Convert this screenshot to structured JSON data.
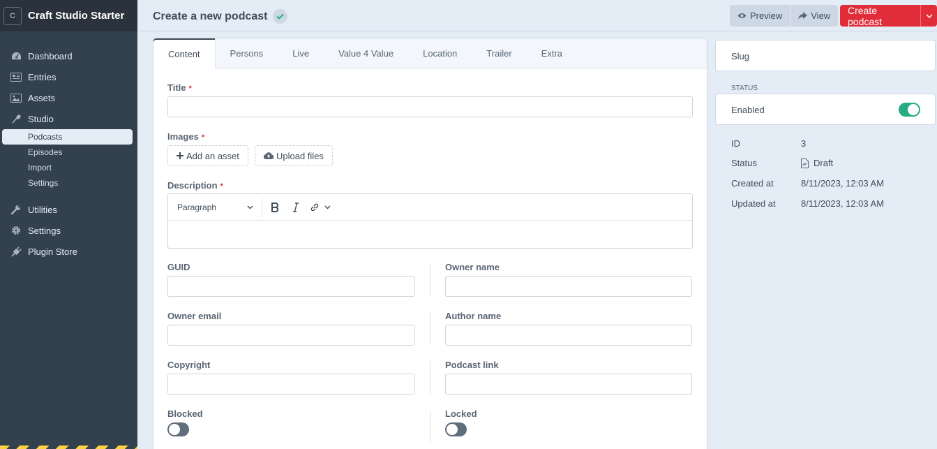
{
  "app": {
    "site_logo_letter": "C",
    "site_name": "Craft Studio Starter"
  },
  "sidebar": {
    "items": [
      {
        "label": "Dashboard",
        "icon": "gauge-icon"
      },
      {
        "label": "Entries",
        "icon": "newspaper-icon"
      },
      {
        "label": "Assets",
        "icon": "image-icon"
      },
      {
        "label": "Studio",
        "icon": "microphone-icon"
      }
    ],
    "studio_subnav": [
      "Podcasts",
      "Episodes",
      "Import",
      "Settings"
    ],
    "bottom_items": [
      {
        "label": "Utilities",
        "icon": "wrench-icon"
      },
      {
        "label": "Settings",
        "icon": "gear-icon"
      },
      {
        "label": "Plugin Store",
        "icon": "plug-icon"
      }
    ]
  },
  "header": {
    "title": "Create a new podcast",
    "preview_label": "Preview",
    "view_label": "View",
    "create_label": "Create podcast"
  },
  "tabs": [
    "Content",
    "Persons",
    "Live",
    "Value 4 Value",
    "Location",
    "Trailer",
    "Extra"
  ],
  "form": {
    "title_label": "Title",
    "images_label": "Images",
    "add_asset_label": "Add an asset",
    "upload_files_label": "Upload files",
    "description_label": "Description",
    "paragraph_option": "Paragraph",
    "guid_label": "GUID",
    "owner_name_label": "Owner name",
    "owner_email_label": "Owner email",
    "author_name_label": "Author name",
    "copyright_label": "Copyright",
    "podcast_link_label": "Podcast link",
    "blocked_label": "Blocked",
    "locked_label": "Locked",
    "required_mark": "*"
  },
  "meta": {
    "slug_label": "Slug",
    "status_heading": "Status",
    "enabled_label": "Enabled",
    "enabled": true,
    "rows": [
      {
        "key": "ID",
        "value": "3"
      },
      {
        "key": "Status",
        "value": "Draft"
      },
      {
        "key": "Created at",
        "value": "8/11/2023, 12:03 AM"
      },
      {
        "key": "Updated at",
        "value": "8/11/2023, 12:03 AM"
      }
    ]
  },
  "colors": {
    "sidebar_bg": "#33404d",
    "primary_red": "#e12d39",
    "toggle_green": "#27ab83",
    "page_bg": "#e4edf6"
  }
}
